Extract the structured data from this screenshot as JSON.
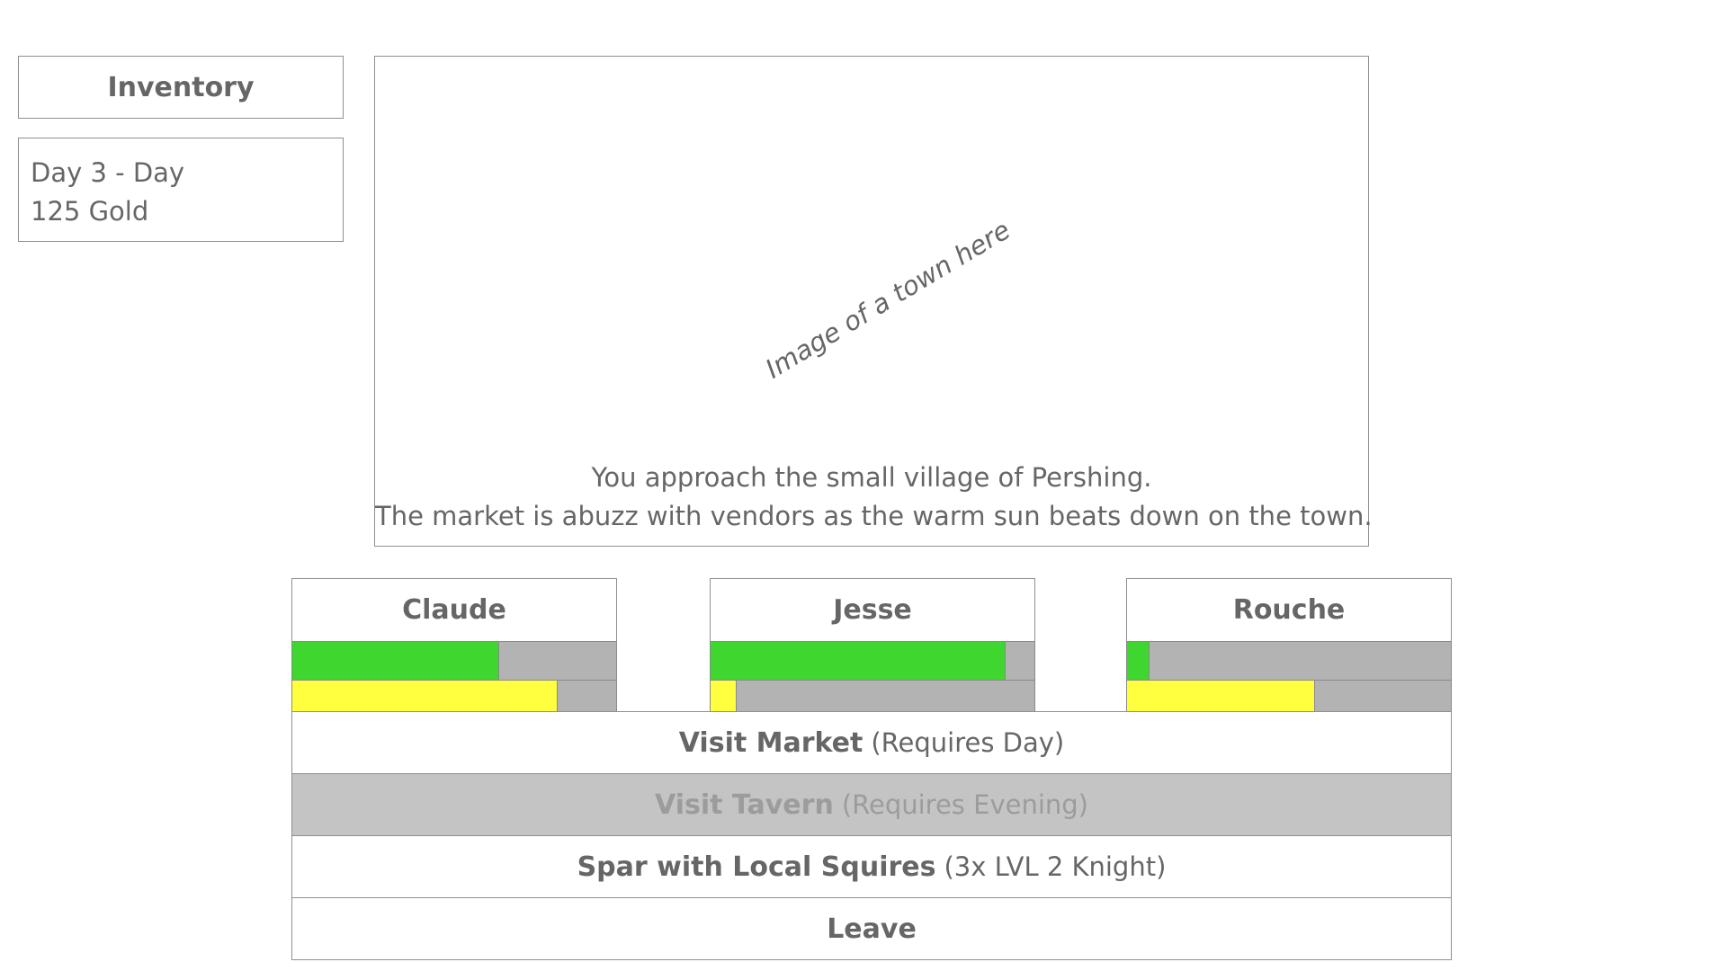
{
  "sidebar": {
    "inventory_label": "Inventory",
    "day_status": "Day 3 - Day",
    "gold": "125 Gold"
  },
  "scene": {
    "image_placeholder": "Image of a town here",
    "line1": "You approach the small village of Pershing.",
    "line2": "The market is abuzz with vendors as the warm sun beats down on the town."
  },
  "party": [
    {
      "name": "Claude",
      "health": 0.64,
      "stamina": 0.82
    },
    {
      "name": "Jesse",
      "health": 0.91,
      "stamina": 0.08
    },
    {
      "name": "Rouche",
      "health": 0.07,
      "stamina": 0.58
    }
  ],
  "actions": [
    {
      "label": "Visit Market",
      "detail": "(Requires Day)",
      "enabled": true
    },
    {
      "label": "Visit Tavern",
      "detail": "(Requires Evening)",
      "enabled": false
    },
    {
      "label": "Spar with Local Squires",
      "detail": "(3x LVL 2 Knight)",
      "enabled": true
    },
    {
      "label": "Leave",
      "detail": "",
      "enabled": true
    }
  ],
  "colors": {
    "health_bar": "#3fd62f",
    "stamina_bar": "#ffff3f",
    "bar_track": "#b3b3b3",
    "disabled_action": "#c4c4c4",
    "text": "#666666"
  }
}
